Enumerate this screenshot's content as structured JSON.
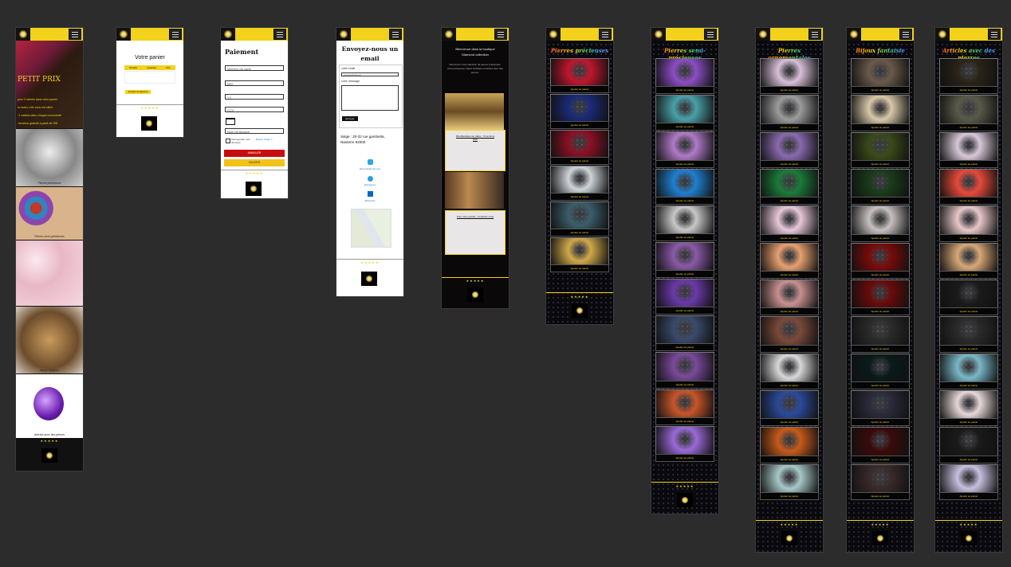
{
  "colors": {
    "canvas": "#2c2c2c",
    "accent": "#f2d21b",
    "dark": "#0a0a0e"
  },
  "icons": {
    "menu": "hamburger-menu-icon",
    "logo": "diamond-logo-icon",
    "card": "card-icon",
    "mail": "mail-icon",
    "telegram": "telegram-icon",
    "linkedin": "linkedin-icon"
  },
  "frame1": {
    "banner": "PETIT PRIX",
    "promo": [
      "pour 3 articles dans votre panier",
      "la moins cher vous est offert",
      "-1 cadeau dans chaque commande",
      "-livraison gratuite à partir de 20€"
    ],
    "captions": [
      "Pierres précieuses",
      "Pierres semi-précieuses",
      "Bijoux fantaisie",
      "Articles avec des pierres"
    ],
    "stars": "★★★★★"
  },
  "frame2": {
    "title": "Votre panier",
    "columns": [
      "Produit",
      "Quantité",
      "Prix"
    ],
    "button": "procéder au paiement",
    "stars": "★★★★★"
  },
  "frame3": {
    "title": "Paiement",
    "fields": [
      "Numéro de carte",
      "MM",
      "YY",
      "CCV",
      "Nom du titulaire"
    ],
    "save_label": "Sauvegarder mes données",
    "link": "Besoin d'aide ?",
    "cancel": "ANNULER",
    "validate": "VALIDER",
    "stars": "★★★★★"
  },
  "frame4": {
    "title": "Envoyez-nous un email",
    "email_label": "votre email",
    "email_placeholder": "exemple@mail.com",
    "message_label": "votre message",
    "submit": "Envoyer",
    "address": "Siège : 20-32 rue gambetta, Nanterre 92000",
    "mail_text": "diamond@mail.com",
    "telegram_text": "@telegram",
    "linkedin_text": "@linkedin",
    "stars": "★★★★★"
  },
  "frame5": {
    "title": "Bienvenue dans la boutique Diamond collection",
    "intro": "Découvrez notre sélection de pierres précieuses, semi-précieuses, bijoux fantaisie et articles avec des pierres.",
    "box1": "Mini-Boutique sur place : 3 rue de la Paix",
    "box2": "Pour nous joindre : contactez nous",
    "stars": "★★★★★"
  },
  "categories": [
    {
      "title": "Pierres précieuses",
      "count": 6
    },
    {
      "title": "Pierres semi-précieuses",
      "count": 11
    },
    {
      "title": "Pierres ornementales",
      "count": 12
    },
    {
      "title": "Bijoux fantaisie",
      "count": 12
    },
    {
      "title": "Articles avec des pierres",
      "count": 12
    }
  ],
  "tile_label": "Ajouter au panier",
  "stars": "★★★★★"
}
